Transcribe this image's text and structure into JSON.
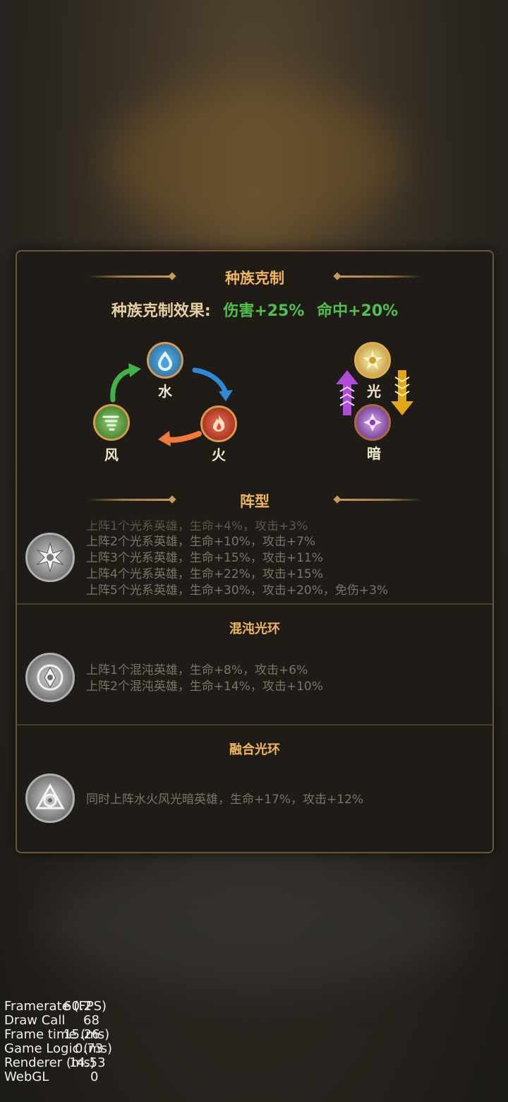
{
  "colors": {
    "accent_title": "#f0b65a",
    "bonus_green": "#4fc24a",
    "panel_bg": "#1f1b17",
    "panel_border": "#6b5638"
  },
  "panel": {
    "title": "种族克制",
    "effect_label": "种族克制效果:",
    "effect_damage": "伤害+25%",
    "effect_hit": "命中+20%"
  },
  "elements": {
    "water": {
      "label": "水",
      "icon": "water-drop-icon"
    },
    "fire": {
      "label": "火",
      "icon": "fire-icon"
    },
    "wind": {
      "label": "风",
      "icon": "wind-icon"
    },
    "light": {
      "label": "光",
      "icon": "light-sun-icon"
    },
    "dark": {
      "label": "暗",
      "icon": "dark-icon"
    }
  },
  "formation": {
    "title": "阵型",
    "sections": [
      {
        "title": "",
        "icon": "light-star-badge-icon",
        "lines": [
          "上阵1个光系英雄，生命+4%，攻击+3%",
          "上阵2个光系英雄，生命+10%，攻击+7%",
          "上阵3个光系英雄，生命+15%，攻击+11%",
          "上阵4个光系英雄，生命+22%，攻击+15%",
          "上阵5个光系英雄，生命+30%，攻击+20%，免伤+3%"
        ]
      },
      {
        "title": "混沌光环",
        "icon": "chaos-badge-icon",
        "lines": [
          "上阵1个混沌英雄，生命+8%，攻击+6%",
          "上阵2个混沌英雄，生命+14%，攻击+10%"
        ]
      },
      {
        "title": "融合光环",
        "icon": "fusion-badge-icon",
        "lines": [
          "同时上阵水火风光暗英雄，生命+17%，攻击+12%"
        ]
      }
    ]
  },
  "debug": {
    "rows": [
      {
        "key": "Framerate (FPS)",
        "value": "60.2"
      },
      {
        "key": "Draw Call",
        "value": "68"
      },
      {
        "key": "Frame time (ms)",
        "value": "15.26"
      },
      {
        "key": "Game Logic (ms)",
        "value": "0.73"
      },
      {
        "key": "Renderer (ms)",
        "value": "14.53"
      },
      {
        "key": "WebGL",
        "value": "0"
      }
    ]
  }
}
